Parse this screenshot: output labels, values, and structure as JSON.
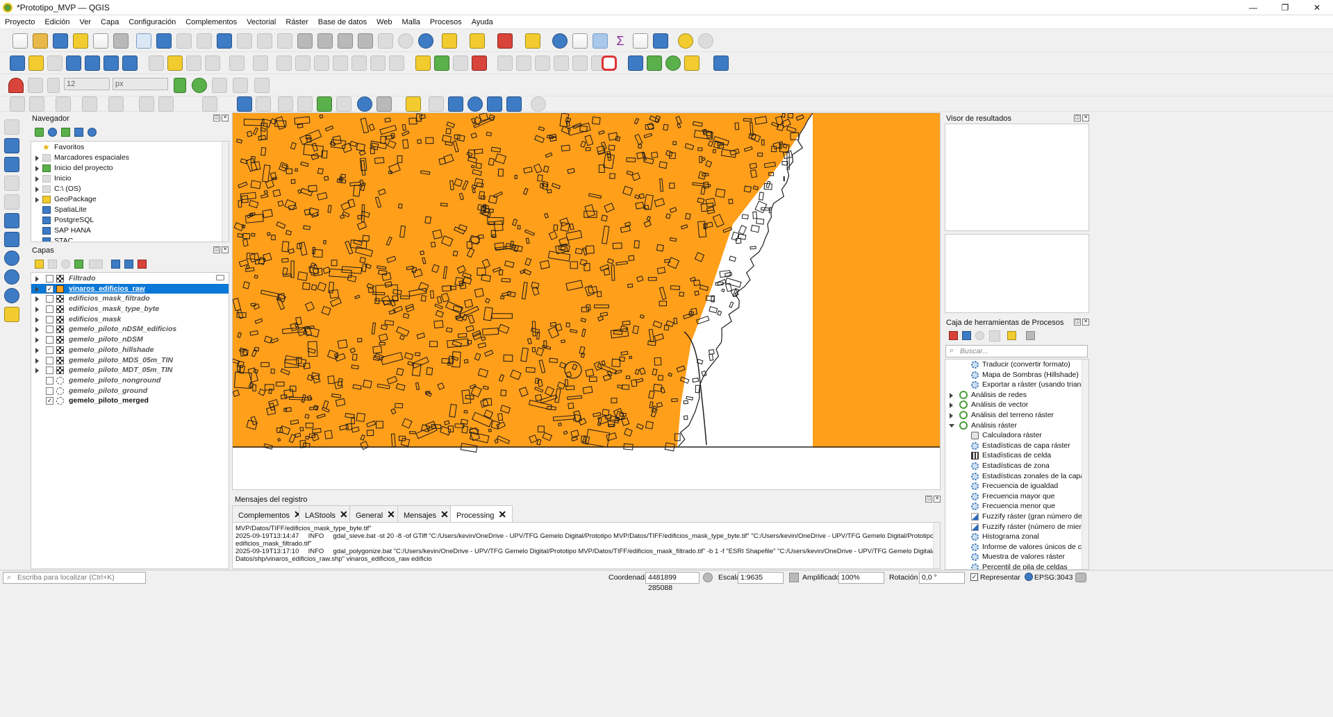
{
  "window": {
    "title": "*Prototipo_MVP — QGIS",
    "min": "—",
    "max": "❐",
    "close": "✕"
  },
  "menu": [
    "Proyecto",
    "Edición",
    "Ver",
    "Capa",
    "Configuración",
    "Complementos",
    "Vectorial",
    "Ráster",
    "Base de datos",
    "Web",
    "Malla",
    "Procesos",
    "Ayuda"
  ],
  "snap": {
    "tolerance": "12",
    "unit": "px"
  },
  "navigator": {
    "title": "Navegador",
    "items": [
      {
        "label": "Favoritos",
        "icon": "star-icon",
        "expand": false
      },
      {
        "label": "Marcadores espaciales",
        "icon": "bookmark-icon",
        "expand": true
      },
      {
        "label": "Inicio del proyecto",
        "icon": "project-home-icon",
        "expand": true
      },
      {
        "label": "Inicio",
        "icon": "home-folder-icon",
        "expand": true
      },
      {
        "label": "C:\\ (OS)",
        "icon": "drive-icon",
        "expand": true
      },
      {
        "label": "GeoPackage",
        "icon": "geopackage-icon",
        "expand": true
      },
      {
        "label": "SpatiaLite",
        "icon": "spatialite-icon",
        "expand": false
      },
      {
        "label": "PostgreSQL",
        "icon": "postgresql-icon",
        "expand": false
      },
      {
        "label": "SAP HANA",
        "icon": "saphana-icon",
        "expand": false
      },
      {
        "label": "STAC",
        "icon": "stac-icon",
        "expand": false
      }
    ]
  },
  "layers": {
    "title": "Capas",
    "items": [
      {
        "label": "Filtrado",
        "type": "raster",
        "checked": false,
        "selected": false,
        "bold": false,
        "expand": true
      },
      {
        "label": "vinaros_edificios_raw",
        "type": "polygon",
        "checked": true,
        "selected": true,
        "bold": false,
        "expand": true
      },
      {
        "label": "edificios_mask_filtrado",
        "type": "raster",
        "checked": false,
        "selected": false,
        "bold": false,
        "expand": true
      },
      {
        "label": "edificios_mask_type_byte",
        "type": "raster",
        "checked": false,
        "selected": false,
        "bold": false,
        "expand": true
      },
      {
        "label": "edificios_mask",
        "type": "raster",
        "checked": false,
        "selected": false,
        "bold": false,
        "expand": true
      },
      {
        "label": "gemelo_piloto_nDSM_edificios",
        "type": "raster",
        "checked": false,
        "selected": false,
        "bold": false,
        "expand": true
      },
      {
        "label": "gemelo_piloto_nDSM",
        "type": "raster",
        "checked": false,
        "selected": false,
        "bold": false,
        "expand": true
      },
      {
        "label": "gemelo_piloto_hillshade",
        "type": "raster",
        "checked": false,
        "selected": false,
        "bold": false,
        "expand": true
      },
      {
        "label": "gemelo_piloto_MDS_05m_TIN",
        "type": "raster",
        "checked": false,
        "selected": false,
        "bold": false,
        "expand": true
      },
      {
        "label": "gemelo_piloto_MDT_05m_TIN",
        "type": "raster",
        "checked": false,
        "selected": false,
        "bold": false,
        "expand": true
      },
      {
        "label": "gemelo_piloto_nonground",
        "type": "pointcloud",
        "checked": false,
        "selected": false,
        "bold": false,
        "expand": false
      },
      {
        "label": "gemelo_piloto_ground",
        "type": "pointcloud",
        "checked": false,
        "selected": false,
        "bold": false,
        "expand": false
      },
      {
        "label": "gemelo_piloto_merged",
        "type": "pointcloud",
        "checked": true,
        "selected": false,
        "bold": true,
        "expand": false
      }
    ]
  },
  "map": {
    "fill_color": "#ff9f1a",
    "outline_color": "#1a1a1a"
  },
  "log": {
    "title": "Mensajes del registro",
    "tabs": [
      "Complementos",
      "LAStools",
      "General",
      "Mensajes",
      "Processing"
    ],
    "active_tab": "Processing",
    "lines": [
      "MVP/Datos/TIFF/edificios_mask_type_byte.tif\"",
      "2025-09-19T13:14:47     INFO     gdal_sieve.bat -st 20 -8 -of GTiff \"C:/Users/kevin/OneDrive - UPV/TFG Gemelo Digital/Prototipo MVP/Datos/TIFF/edificios_mask_type_byte.tif\" \"C:/Users/kevin/OneDrive - UPV/TFG Gemelo Digital/Prototipo MVP/Datos/TIFF/",
      "edificios_mask_filtrado.tif\"",
      "2025-09-19T13:17:10     INFO     gdal_polygonize.bat \"C:/Users/kevin/OneDrive - UPV/TFG Gemelo Digital/Prototipo MVP/Datos/TIFF/edificios_mask_filtrado.tif\" -b 1 -f \"ESRI Shapefile\" \"C:/Users/kevin/OneDrive - UPV/TFG Gemelo Digital/Prototipo MVP/",
      "Datos/shp/vinaros_edificios_raw.shp\" vinaros_edificios_raw edificio"
    ]
  },
  "results": {
    "title": "Visor de resultados"
  },
  "toolbox": {
    "title": "Caja de herramientas de Procesos",
    "search_placeholder": "Buscar...",
    "items": [
      {
        "label": "Traducir (convertir formato)",
        "level": 2,
        "kind": "gear"
      },
      {
        "label": "Mapa de Sombras (Hillshade)",
        "level": 2,
        "kind": "gear"
      },
      {
        "label": "Exportar a ráster (usando triangu…",
        "level": 2,
        "kind": "gear"
      },
      {
        "label": "Análisis de redes",
        "level": 1,
        "kind": "group",
        "open": false
      },
      {
        "label": "Análisis de vector",
        "level": 1,
        "kind": "group",
        "open": false
      },
      {
        "label": "Análisis del terreno ráster",
        "level": 1,
        "kind": "group",
        "open": false
      },
      {
        "label": "Análisis ráster",
        "level": 1,
        "kind": "group",
        "open": true
      },
      {
        "label": "Calculadora ráster",
        "level": 2,
        "kind": "calc"
      },
      {
        "label": "Estadísticas de capa ráster",
        "level": 2,
        "kind": "gear"
      },
      {
        "label": "Estadísticas de celda",
        "level": 2,
        "kind": "grid"
      },
      {
        "label": "Estadísticas de zona",
        "level": 2,
        "kind": "gear"
      },
      {
        "label": "Estadísticas zonales de la capa rá…",
        "level": 2,
        "kind": "gear"
      },
      {
        "label": "Frecuencia de igualdad",
        "level": 2,
        "kind": "gear"
      },
      {
        "label": "Frecuencia mayor que",
        "level": 2,
        "kind": "gear"
      },
      {
        "label": "Frecuencia menor que",
        "level": 2,
        "kind": "gear"
      },
      {
        "label": "Fuzzify ráster (gran número de mi…",
        "level": 2,
        "kind": "fuzzy"
      },
      {
        "label": "Fuzzify ráster (número de miembr…",
        "level": 2,
        "kind": "fuzzy"
      },
      {
        "label": "Histograma zonal",
        "level": 2,
        "kind": "gear"
      },
      {
        "label": "Informe de valores únicos de cap…",
        "level": 2,
        "kind": "gear"
      },
      {
        "label": "Muestra de valores ráster",
        "level": 2,
        "kind": "gear"
      },
      {
        "label": "Percentil de pila de celdas",
        "level": 2,
        "kind": "gear"
      }
    ]
  },
  "status": {
    "locate_placeholder": "Escriba para localizar (Ctrl+K)",
    "coord_label": "Coordenada",
    "coord_value": "4481899  285088",
    "scale_label": "Escala",
    "scale_value": "1:9635",
    "magnifier_label": "Amplificador",
    "magnifier_value": "100%",
    "rotation_label": "Rotación",
    "rotation_value": "0,0 °",
    "render_label": "Representar",
    "crs": "EPSG:3043"
  }
}
